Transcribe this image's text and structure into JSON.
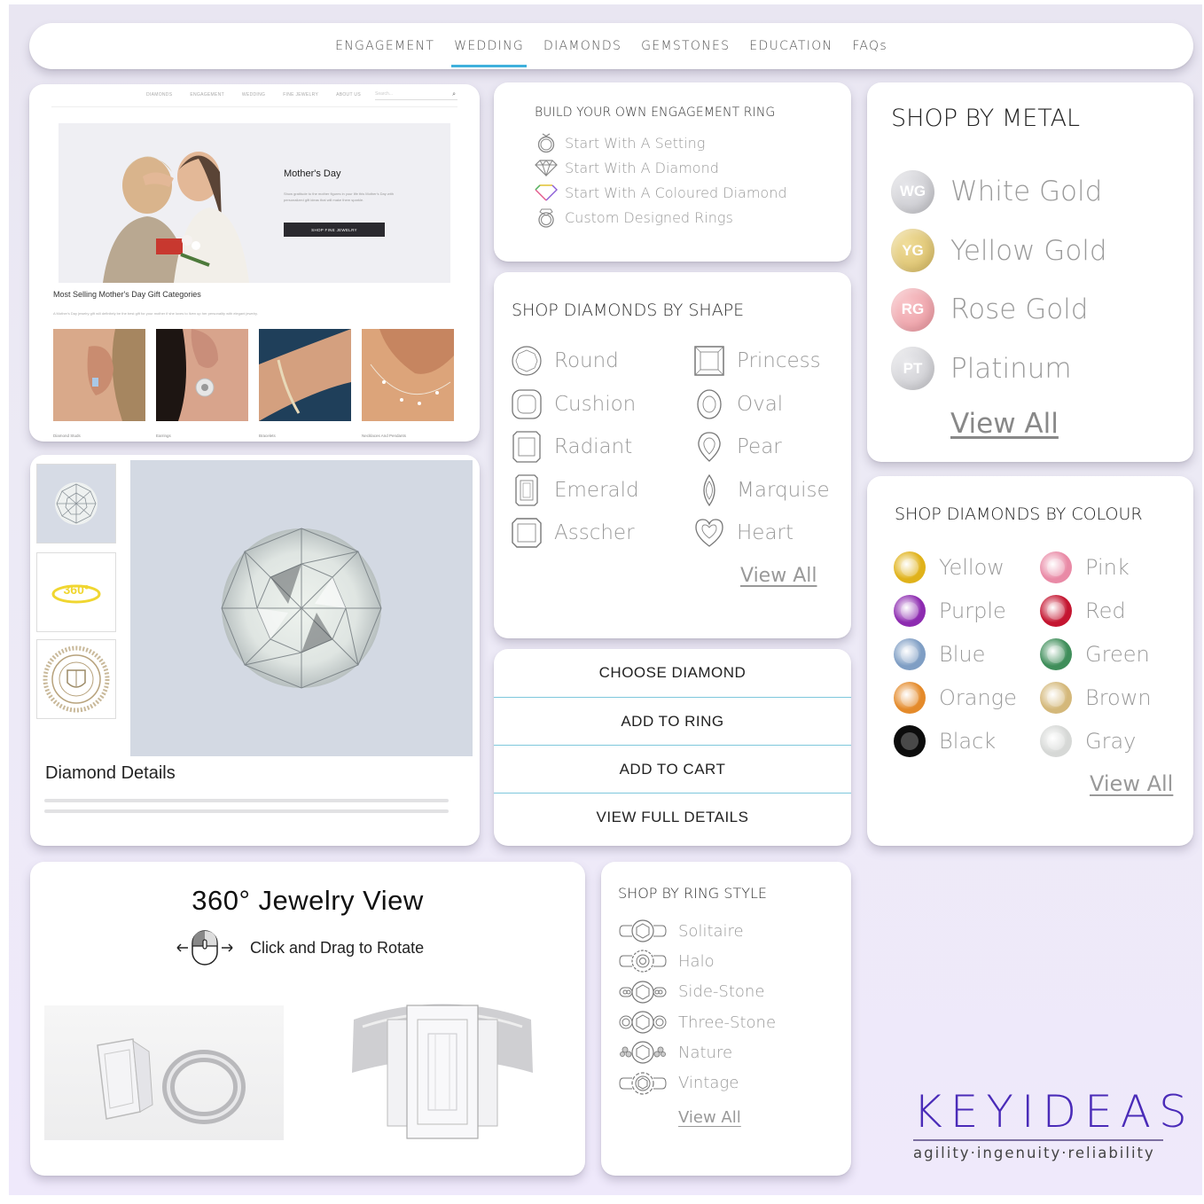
{
  "top_nav": {
    "items": [
      {
        "label": "ENGAGEMENT",
        "active": false
      },
      {
        "label": "WEDDING",
        "active": true
      },
      {
        "label": "DIAMONDS",
        "active": false
      },
      {
        "label": "GEMSTONES",
        "active": false
      },
      {
        "label": "EDUCATION",
        "active": false
      },
      {
        "label": "FAQs",
        "active": false
      }
    ],
    "accent_color": "#3fb0dc"
  },
  "mini_site": {
    "nav": [
      "DIAMONDS",
      "ENGAGEMENT",
      "WEDDING",
      "FINE JEWELRY",
      "ABOUT US"
    ],
    "search_placeholder": "Search...",
    "hero": {
      "title": "Mother's Day",
      "text": "Show gratitude to the mother figures in your life this Mother's Day with personalized gift ideas that will make them sparkle.",
      "button": "SHOP FINE JEWELRY"
    },
    "categories_title": "Most Selling Mother's Day Gift Categories",
    "categories_subtitle": "A Mother's Day jewelry gift will definitely be the best gift for your mother if she loves to liven up her personality with elegant jewelry.",
    "categories": [
      {
        "label": "Diamond Studs"
      },
      {
        "label": "Earrings"
      },
      {
        "label": "Bracelets"
      },
      {
        "label": "Necklaces And Pendants"
      }
    ]
  },
  "diamond_detail": {
    "thumbnails": [
      "diamond-photo",
      "360-view",
      "certificate-seal"
    ],
    "thumb_360_label": "360°",
    "title": "Diamond Details"
  },
  "build_ring": {
    "title": "BUILD YOUR OWN ENGAGEMENT RING",
    "items": [
      {
        "label": "Start With A Setting",
        "icon": "ring-icon"
      },
      {
        "label": "Start With A Diamond",
        "icon": "diamond-icon"
      },
      {
        "label": "Start With A Coloured Diamond",
        "icon": "coloured-diamond-icon"
      },
      {
        "label": "Custom Designed Rings",
        "icon": "custom-ring-icon"
      }
    ]
  },
  "shapes": {
    "title": "SHOP DIAMONDS BY SHAPE",
    "items": [
      {
        "label": "Round"
      },
      {
        "label": "Princess"
      },
      {
        "label": "Cushion"
      },
      {
        "label": "Oval"
      },
      {
        "label": "Radiant"
      },
      {
        "label": "Pear"
      },
      {
        "label": "Emerald"
      },
      {
        "label": "Marquise"
      },
      {
        "label": "Asscher"
      },
      {
        "label": "Heart"
      }
    ],
    "view_all": "View All"
  },
  "metal": {
    "title": "SHOP BY METAL",
    "items": [
      {
        "code": "WG",
        "label": "White Gold",
        "color": "#c9c9cd"
      },
      {
        "code": "YG",
        "label": "Yellow Gold",
        "color": "#dcc67a"
      },
      {
        "code": "RG",
        "label": "Rose Gold",
        "color": "#eda5ad"
      },
      {
        "code": "PT",
        "label": "Platinum",
        "color": "#cfcfd3"
      }
    ],
    "view_all": "View All"
  },
  "actions": {
    "buttons": [
      "CHOOSE DIAMOND",
      "ADD TO RING",
      "ADD TO CART",
      "VIEW FULL DETAILS"
    ]
  },
  "colour": {
    "title": "SHOP DIAMONDS BY COLOUR",
    "items": [
      {
        "label": "Yellow",
        "color": "#e0b21a"
      },
      {
        "label": "Pink",
        "color": "#e98aa6"
      },
      {
        "label": "Purple",
        "color": "#8d2bb0"
      },
      {
        "label": "Red",
        "color": "#c41530"
      },
      {
        "label": "Blue",
        "color": "#7f9ec4"
      },
      {
        "label": "Green",
        "color": "#3f8e5a"
      },
      {
        "label": "Orange",
        "color": "#e48a2a"
      },
      {
        "label": "Brown",
        "color": "#d4b87a"
      },
      {
        "label": "Black",
        "color": "#0c0c0c"
      },
      {
        "label": "Gray",
        "color": "#d6d8d6"
      }
    ],
    "view_all": "View All"
  },
  "viewer": {
    "title": "360° Jewelry View",
    "hint": "Click and Drag to Rotate"
  },
  "ring_style": {
    "title": "SHOP BY RING STYLE",
    "items": [
      {
        "label": "Solitaire"
      },
      {
        "label": "Halo"
      },
      {
        "label": "Side-Stone"
      },
      {
        "label": "Three-Stone"
      },
      {
        "label": "Nature"
      },
      {
        "label": "Vintage"
      }
    ],
    "view_all": "View All"
  },
  "logo": {
    "word": "KEYIDEAS",
    "tagline": "agility·ingenuity·reliability",
    "color": "#4a2bb8"
  }
}
